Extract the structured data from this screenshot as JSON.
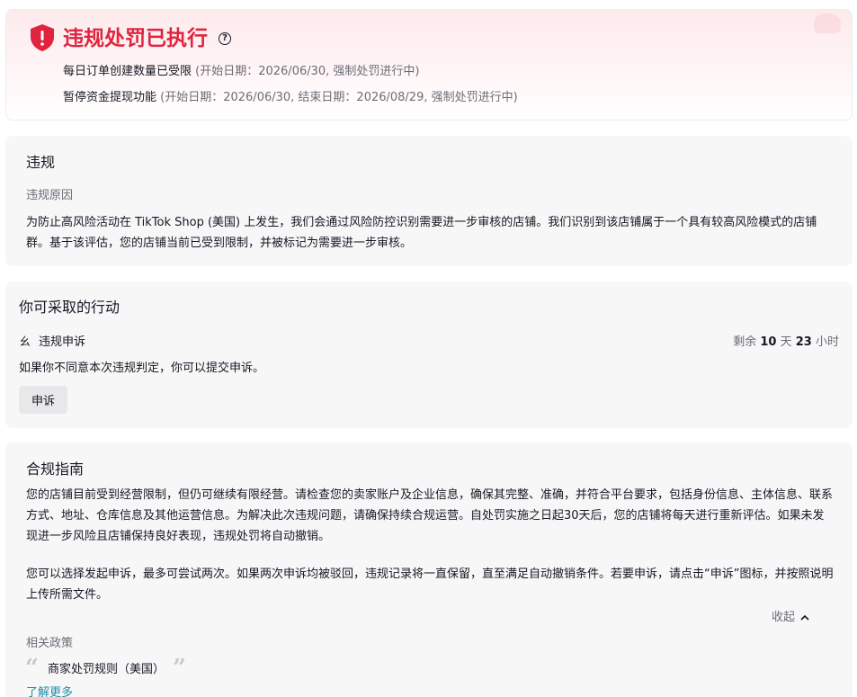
{
  "banner": {
    "title": "违规处罚已执行",
    "help_icon": "?",
    "items": [
      {
        "text": "每日订单创建数量已受限",
        "detail": "(开始日期：2026/06/30, 强制处罚进行中)"
      },
      {
        "text": "暂停资金提现功能",
        "detail": "(开始日期：2026/06/30, 结束日期：2026/08/29, 强制处罚进行中)"
      }
    ],
    "accent_color": "#e0243f"
  },
  "violation": {
    "title": "违规",
    "reason_label": "违规原因",
    "reason_text": "为防止高风险活动在 TikTok Shop (美国) 上发生，我们会通过风险防控识别需要进一步审核的店铺。我们识别到该店铺属于一个具有较高风险模式的店铺群。基于该评估，您的店铺当前已受到限制，并被标记为需要进一步审核。"
  },
  "actions": {
    "title": "你可采取的行动",
    "appeal_icon": "ㄠ",
    "appeal_label": "违规申诉",
    "remaining": {
      "prefix": "剩余",
      "days": "10",
      "days_unit": "天",
      "hours": "23",
      "hours_unit": "小时"
    },
    "description": "如果你不同意本次违规判定，你可以提交申诉。",
    "appeal_button": "申诉"
  },
  "guide": {
    "title": "合规指南",
    "paragraph_1": "您的店铺目前受到经营限制，但仍可继续有限经营。请检查您的卖家账户及企业信息，确保其完整、准确，并符合平台要求，包括身份信息、主体信息、联系方式、地址、仓库信息及其他运营信息。为解决此次违规问题，请确保持续合规运营。自处罚实施之日起30天后，您的店铺将每天进行重新评估。如果未发现进一步风险且店铺保持良好表现，违规处罚将自动撤销。",
    "paragraph_2": "您可以选择发起申诉，最多可尝试两次。如果两次申诉均被驳回，违规记录将一直保留，直至满足自动撤销条件。若要申诉，请点击“申诉”图标，并按照说明上传所需文件。",
    "collapse_label": "收起",
    "related_label": "相关政策",
    "policy_link": "商家处罚规则（美国）",
    "quote_open": "“",
    "quote_close": "”",
    "more_link": "了解更多"
  }
}
